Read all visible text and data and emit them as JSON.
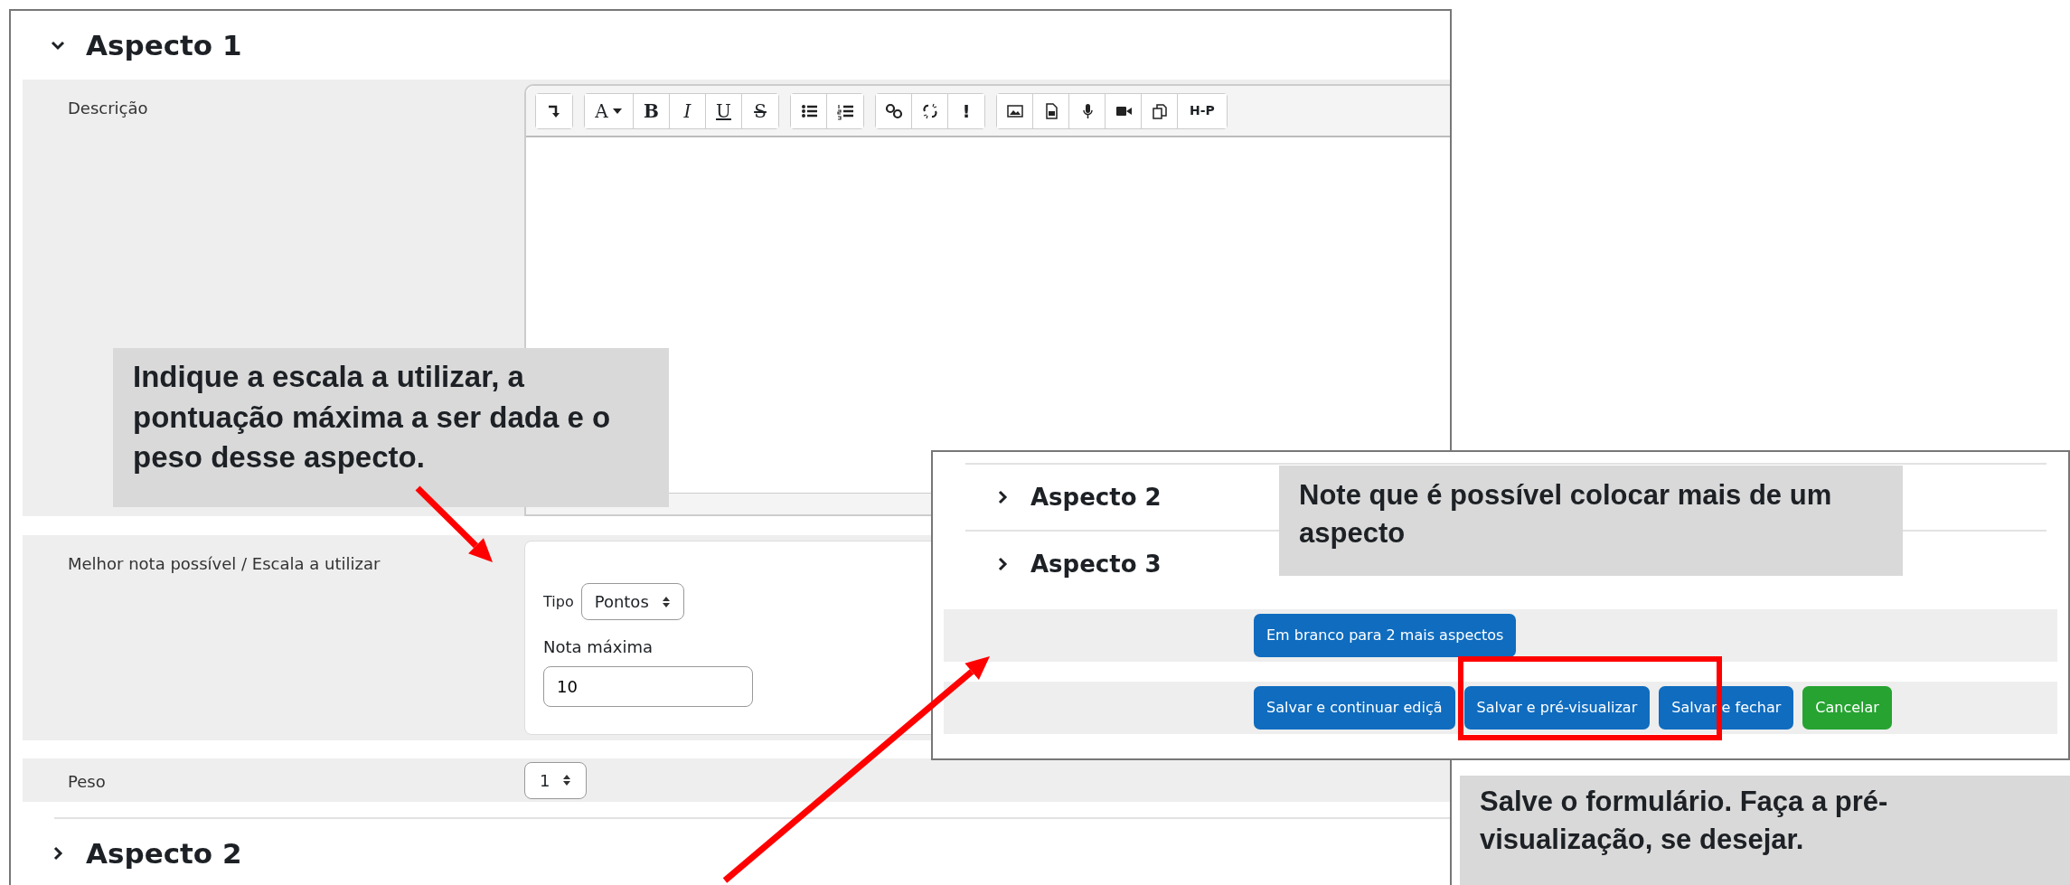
{
  "main": {
    "section": {
      "title": "Aspecto 1",
      "expanded": true
    },
    "description": {
      "label": "Descrição",
      "toolbar": [
        [
          {
            "kind": "icon"
          }
        ],
        [
          {
            "kind": "menu",
            "label": "A"
          },
          {
            "kind": "bold",
            "label": "B"
          },
          {
            "kind": "italic",
            "label": "I"
          },
          {
            "kind": "underline",
            "label": "U"
          },
          {
            "kind": "strike",
            "label": "S"
          }
        ],
        [
          {
            "kind": "icon"
          },
          {
            "kind": "icon"
          }
        ],
        [
          {
            "kind": "icon"
          },
          {
            "kind": "icon"
          },
          {
            "kind": "glyph",
            "label": "!"
          }
        ],
        [
          {
            "kind": "icon"
          },
          {
            "kind": "icon"
          },
          {
            "kind": "icon"
          },
          {
            "kind": "icon"
          },
          {
            "kind": "icon"
          },
          {
            "kind": "glyph",
            "label": "H-P"
          }
        ]
      ]
    },
    "grade": {
      "label": "Melhor nota possível / Escala a utilizar",
      "type_label": "Tipo",
      "type_value": "Pontos",
      "max_label": "Nota máxima",
      "max_value": "10"
    },
    "weight": {
      "label": "Peso",
      "value": "1"
    },
    "more_sections": [
      {
        "title": "Aspecto 2",
        "expanded": false
      }
    ]
  },
  "inset": {
    "sections": [
      {
        "title": "Aspecto 2",
        "expanded": false
      },
      {
        "title": "Aspecto 3",
        "expanded": false
      }
    ],
    "add_button": "Em branco para 2 mais aspectos",
    "buttons": [
      {
        "label": "Salvar e continuar ediçã",
        "kind": "primary"
      },
      {
        "label": "Salvar e pré-visualizar",
        "kind": "primary"
      },
      {
        "label": "Salvar e fechar",
        "kind": "primary"
      },
      {
        "label": "Cancelar",
        "kind": "success"
      }
    ]
  },
  "callouts": [
    {
      "text": "Indique a escala a utilizar, a pontuação máxima a ser dada e o peso desse aspecto."
    },
    {
      "text": "Note que é possível colocar mais de um aspecto"
    },
    {
      "text": "Salve o formulário. Faça a pré-visualização, se desejar."
    }
  ]
}
